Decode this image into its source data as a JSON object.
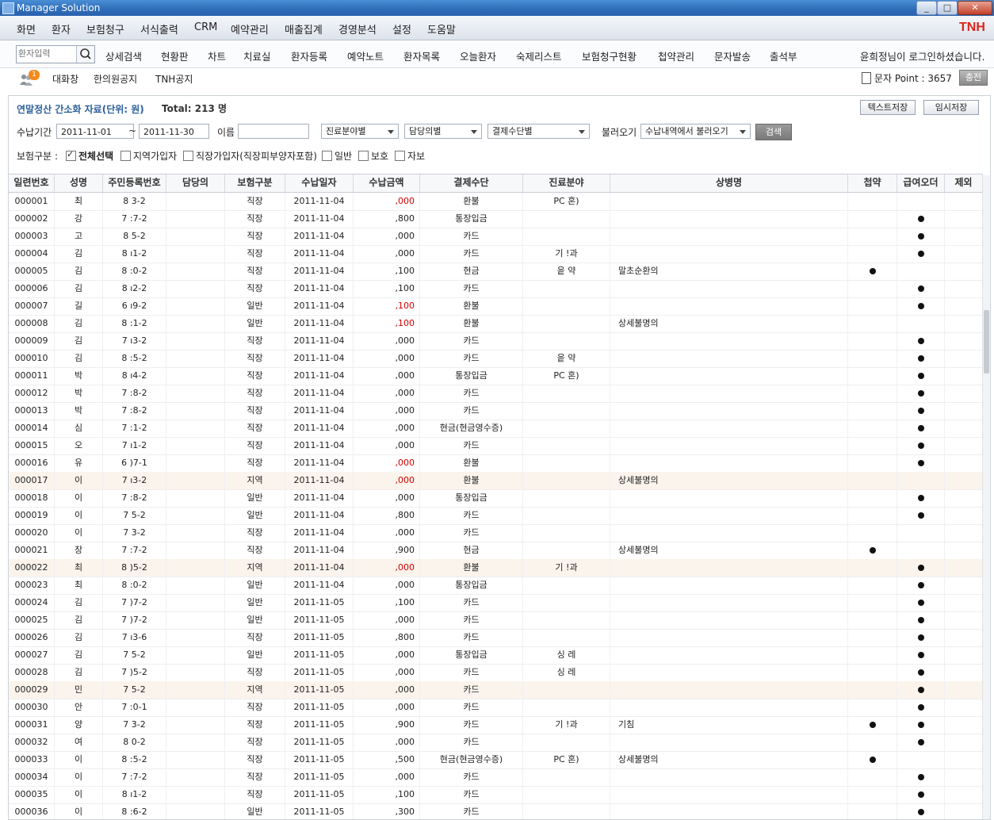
{
  "window": {
    "title": "Manager Solution",
    "brand": "TNH",
    "min": "_",
    "max": "□",
    "close": "✕"
  },
  "menu": [
    "화면",
    "환자",
    "보험청구",
    "서식출력",
    "CRM",
    "예약관리",
    "매출집계",
    "경영분석",
    "설정",
    "도움말"
  ],
  "toolbar": {
    "search_placeholder": "환자입력",
    "items": [
      "상세검색",
      "현황판",
      "차트",
      "치료실",
      "환자등록",
      "예약노트",
      "환자목록",
      "오늘환자",
      "숙제리스트",
      "보험청구현황",
      "첩약관리",
      "문자발송",
      "출석부"
    ],
    "login_msg": "윤희정님이 로그인하셨습니다."
  },
  "subbar": {
    "chat_badge": "1",
    "items": [
      "대화창",
      "한의원공지",
      "TNH공지"
    ],
    "point_label": "문자 Point : 3657",
    "charge_label": "충전"
  },
  "report": {
    "title": "연말정산 간소화 자료(단위: 원)",
    "total": "Total: 213 명",
    "btn_text_save": "텍스트저장",
    "btn_temp_save": "임시저장",
    "period_label": "수납기간",
    "date_from": "2011-11-01",
    "date_sep": "~",
    "date_to": "2011-11-30",
    "name_label": "이름",
    "name_value": "",
    "dd_field": "진료분야별",
    "dd_doctor": "담당의별",
    "dd_pay": "결제수단별",
    "load_label": "불러오기",
    "dd_load": "수납내역에서 불러오기",
    "search_btn": "검색",
    "insurance_label": "보험구분 :",
    "checks": [
      {
        "label": "전체선택",
        "checked": true
      },
      {
        "label": "지역가입자",
        "checked": false
      },
      {
        "label": "직장가입자(직장피부양자포함)",
        "checked": false
      },
      {
        "label": "일반",
        "checked": false
      },
      {
        "label": "보호",
        "checked": false
      },
      {
        "label": "자보",
        "checked": false
      }
    ]
  },
  "table": {
    "columns": [
      "일련번호",
      "성명",
      "주민등록번호",
      "담당의",
      "보험구분",
      "수납일자",
      "수납금액",
      "결제수단",
      "진료분야",
      "상병명",
      "첩약",
      "급여오더",
      "제외"
    ],
    "rows": [
      {
        "no": "000001",
        "name": "최",
        "rrn": "8 3-2",
        "ins": "직장",
        "date": "2011-11-04",
        "amt": ",000",
        "red": true,
        "pay": "환불",
        "field": "PC 혼)",
        "dis": "",
        "chup": false,
        "order": false,
        "hl": false
      },
      {
        "no": "000002",
        "name": "강",
        "rrn": "7 :7-2",
        "ins": "직장",
        "date": "2011-11-04",
        "amt": ",800",
        "red": false,
        "pay": "통장입금",
        "field": "",
        "dis": "",
        "chup": false,
        "order": true,
        "hl": false
      },
      {
        "no": "000003",
        "name": "고",
        "rrn": "8 5-2",
        "ins": "직장",
        "date": "2011-11-04",
        "amt": ",000",
        "red": false,
        "pay": "카드",
        "field": "",
        "dis": "",
        "chup": false,
        "order": true,
        "hl": false
      },
      {
        "no": "000004",
        "name": "김",
        "rrn": "8 ı1-2",
        "ins": "직장",
        "date": "2011-11-04",
        "amt": ",000",
        "red": false,
        "pay": "카드",
        "field": "기 !과",
        "dis": "",
        "chup": false,
        "order": true,
        "hl": false
      },
      {
        "no": "000005",
        "name": "김",
        "rrn": "8 :0-2",
        "ins": "직장",
        "date": "2011-11-04",
        "amt": ",100",
        "red": false,
        "pay": "현금",
        "field": "읕 약",
        "dis": "말초순환의",
        "chup": true,
        "order": false,
        "hl": false
      },
      {
        "no": "000006",
        "name": "김",
        "rrn": "8 ı2-2",
        "ins": "직장",
        "date": "2011-11-04",
        "amt": ",100",
        "red": false,
        "pay": "카드",
        "field": "",
        "dis": "",
        "chup": false,
        "order": true,
        "hl": false
      },
      {
        "no": "000007",
        "name": "길",
        "rrn": "6 ı9-2",
        "ins": "일반",
        "date": "2011-11-04",
        "amt": ",100",
        "red": true,
        "pay": "환불",
        "field": "",
        "dis": "",
        "chup": false,
        "order": true,
        "hl": false
      },
      {
        "no": "000008",
        "name": "김",
        "rrn": "8 :1-2",
        "ins": "일반",
        "date": "2011-11-04",
        "amt": ",100",
        "red": true,
        "pay": "환불",
        "field": "",
        "dis": "상세불명의",
        "chup": false,
        "order": false,
        "hl": false
      },
      {
        "no": "000009",
        "name": "김",
        "rrn": "7 ı3-2",
        "ins": "직장",
        "date": "2011-11-04",
        "amt": ",000",
        "red": false,
        "pay": "카드",
        "field": "",
        "dis": "",
        "chup": false,
        "order": true,
        "hl": false
      },
      {
        "no": "000010",
        "name": "김",
        "rrn": "8 :5-2",
        "ins": "직장",
        "date": "2011-11-04",
        "amt": ",000",
        "red": false,
        "pay": "카드",
        "field": "읕 약",
        "dis": "",
        "chup": false,
        "order": true,
        "hl": false
      },
      {
        "no": "000011",
        "name": "박",
        "rrn": "8 ı4-2",
        "ins": "직장",
        "date": "2011-11-04",
        "amt": ",000",
        "red": false,
        "pay": "통장입금",
        "field": "PC 혼)",
        "dis": "",
        "chup": false,
        "order": true,
        "hl": false
      },
      {
        "no": "000012",
        "name": "박",
        "rrn": "7 :8-2",
        "ins": "직장",
        "date": "2011-11-04",
        "amt": ",000",
        "red": false,
        "pay": "카드",
        "field": "",
        "dis": "",
        "chup": false,
        "order": true,
        "hl": false
      },
      {
        "no": "000013",
        "name": "박",
        "rrn": "7 :8-2",
        "ins": "직장",
        "date": "2011-11-04",
        "amt": ",000",
        "red": false,
        "pay": "카드",
        "field": "",
        "dis": "",
        "chup": false,
        "order": true,
        "hl": false
      },
      {
        "no": "000014",
        "name": "심",
        "rrn": "7 :1-2",
        "ins": "직장",
        "date": "2011-11-04",
        "amt": ",000",
        "red": false,
        "pay": "현금(현금영수증)",
        "field": "",
        "dis": "",
        "chup": false,
        "order": true,
        "hl": false
      },
      {
        "no": "000015",
        "name": "오",
        "rrn": "7 ı1-2",
        "ins": "직장",
        "date": "2011-11-04",
        "amt": ",000",
        "red": false,
        "pay": "카드",
        "field": "",
        "dis": "",
        "chup": false,
        "order": true,
        "hl": false
      },
      {
        "no": "000016",
        "name": "유",
        "rrn": "6 )7-1",
        "ins": "직장",
        "date": "2011-11-04",
        "amt": ",000",
        "red": true,
        "pay": "환불",
        "field": "",
        "dis": "",
        "chup": false,
        "order": true,
        "hl": false
      },
      {
        "no": "000017",
        "name": "이",
        "rrn": "7 ı3-2",
        "ins": "지역",
        "date": "2011-11-04",
        "amt": ",000",
        "red": true,
        "pay": "환불",
        "field": "",
        "dis": "상세불명의",
        "chup": false,
        "order": false,
        "hl": true
      },
      {
        "no": "000018",
        "name": "이",
        "rrn": "7 :8-2",
        "ins": "일반",
        "date": "2011-11-04",
        "amt": ",000",
        "red": false,
        "pay": "통장입금",
        "field": "",
        "dis": "",
        "chup": false,
        "order": true,
        "hl": false
      },
      {
        "no": "000019",
        "name": "이",
        "rrn": "7 5-2",
        "ins": "일반",
        "date": "2011-11-04",
        "amt": ",800",
        "red": false,
        "pay": "카드",
        "field": "",
        "dis": "",
        "chup": false,
        "order": true,
        "hl": false
      },
      {
        "no": "000020",
        "name": "이",
        "rrn": "7 3-2",
        "ins": "직장",
        "date": "2011-11-04",
        "amt": ",000",
        "red": false,
        "pay": "카드",
        "field": "",
        "dis": "",
        "chup": false,
        "order": false,
        "hl": false
      },
      {
        "no": "000021",
        "name": "장",
        "rrn": "7 :7-2",
        "ins": "직장",
        "date": "2011-11-04",
        "amt": ",900",
        "red": false,
        "pay": "현금",
        "field": "",
        "dis": "상세불명의",
        "chup": true,
        "order": false,
        "hl": false
      },
      {
        "no": "000022",
        "name": "최",
        "rrn": "8 )5-2",
        "ins": "지역",
        "date": "2011-11-04",
        "amt": ",000",
        "red": true,
        "pay": "환불",
        "field": "기 !과",
        "dis": "",
        "chup": false,
        "order": true,
        "hl": true
      },
      {
        "no": "000023",
        "name": "최",
        "rrn": "8 :0-2",
        "ins": "일반",
        "date": "2011-11-04",
        "amt": ",000",
        "red": false,
        "pay": "통장입금",
        "field": "",
        "dis": "",
        "chup": false,
        "order": true,
        "hl": false
      },
      {
        "no": "000024",
        "name": "김",
        "rrn": "7 )7-2",
        "ins": "일반",
        "date": "2011-11-05",
        "amt": ",100",
        "red": false,
        "pay": "카드",
        "field": "",
        "dis": "",
        "chup": false,
        "order": true,
        "hl": false
      },
      {
        "no": "000025",
        "name": "김",
        "rrn": "7 )7-2",
        "ins": "일반",
        "date": "2011-11-05",
        "amt": ",000",
        "red": false,
        "pay": "카드",
        "field": "",
        "dis": "",
        "chup": false,
        "order": true,
        "hl": false
      },
      {
        "no": "000026",
        "name": "김",
        "rrn": "7 ı3-6",
        "ins": "직장",
        "date": "2011-11-05",
        "amt": ",800",
        "red": false,
        "pay": "카드",
        "field": "",
        "dis": "",
        "chup": false,
        "order": true,
        "hl": false
      },
      {
        "no": "000027",
        "name": "김",
        "rrn": "7 5-2",
        "ins": "일반",
        "date": "2011-11-05",
        "amt": ",000",
        "red": false,
        "pay": "통장입금",
        "field": "싱 레",
        "dis": "",
        "chup": false,
        "order": true,
        "hl": false
      },
      {
        "no": "000028",
        "name": "김",
        "rrn": "7 )5-2",
        "ins": "직장",
        "date": "2011-11-05",
        "amt": ",000",
        "red": false,
        "pay": "카드",
        "field": "싱 레",
        "dis": "",
        "chup": false,
        "order": true,
        "hl": false
      },
      {
        "no": "000029",
        "name": "민",
        "rrn": "7 5-2",
        "ins": "지역",
        "date": "2011-11-05",
        "amt": ",000",
        "red": false,
        "pay": "카드",
        "field": "",
        "dis": "",
        "chup": false,
        "order": true,
        "hl": true
      },
      {
        "no": "000030",
        "name": "안",
        "rrn": "7 :0-1",
        "ins": "직장",
        "date": "2011-11-05",
        "amt": ",000",
        "red": false,
        "pay": "카드",
        "field": "",
        "dis": "",
        "chup": false,
        "order": true,
        "hl": false
      },
      {
        "no": "000031",
        "name": "양",
        "rrn": "7 3-2",
        "ins": "직장",
        "date": "2011-11-05",
        "amt": ",900",
        "red": false,
        "pay": "카드",
        "field": "기 !과",
        "dis": "기침",
        "chup": true,
        "order": true,
        "hl": false
      },
      {
        "no": "000032",
        "name": "여",
        "rrn": "8 0-2",
        "ins": "직장",
        "date": "2011-11-05",
        "amt": ",000",
        "red": false,
        "pay": "카드",
        "field": "",
        "dis": "",
        "chup": false,
        "order": true,
        "hl": false
      },
      {
        "no": "000033",
        "name": "이",
        "rrn": "8 :5-2",
        "ins": "직장",
        "date": "2011-11-05",
        "amt": ",500",
        "red": false,
        "pay": "현금(현금영수증)",
        "field": "PC 혼)",
        "dis": "상세불명의",
        "chup": true,
        "order": false,
        "hl": false
      },
      {
        "no": "000034",
        "name": "이",
        "rrn": "7 :7-2",
        "ins": "직장",
        "date": "2011-11-05",
        "amt": ",000",
        "red": false,
        "pay": "카드",
        "field": "",
        "dis": "",
        "chup": false,
        "order": true,
        "hl": false
      },
      {
        "no": "000035",
        "name": "이",
        "rrn": "8 ı1-2",
        "ins": "직장",
        "date": "2011-11-05",
        "amt": ",100",
        "red": false,
        "pay": "카드",
        "field": "",
        "dis": "",
        "chup": false,
        "order": true,
        "hl": false
      },
      {
        "no": "000036",
        "name": "이",
        "rrn": "8 :6-2",
        "ins": "일반",
        "date": "2011-11-05",
        "amt": ",300",
        "red": false,
        "pay": "카드",
        "field": "",
        "dis": "",
        "chup": false,
        "order": true,
        "hl": false
      }
    ]
  },
  "colors": {
    "accent": "#2b5f9a",
    "refund": "#d20000",
    "brand": "#e0241a",
    "highlight_row": "#fbf4ec"
  }
}
